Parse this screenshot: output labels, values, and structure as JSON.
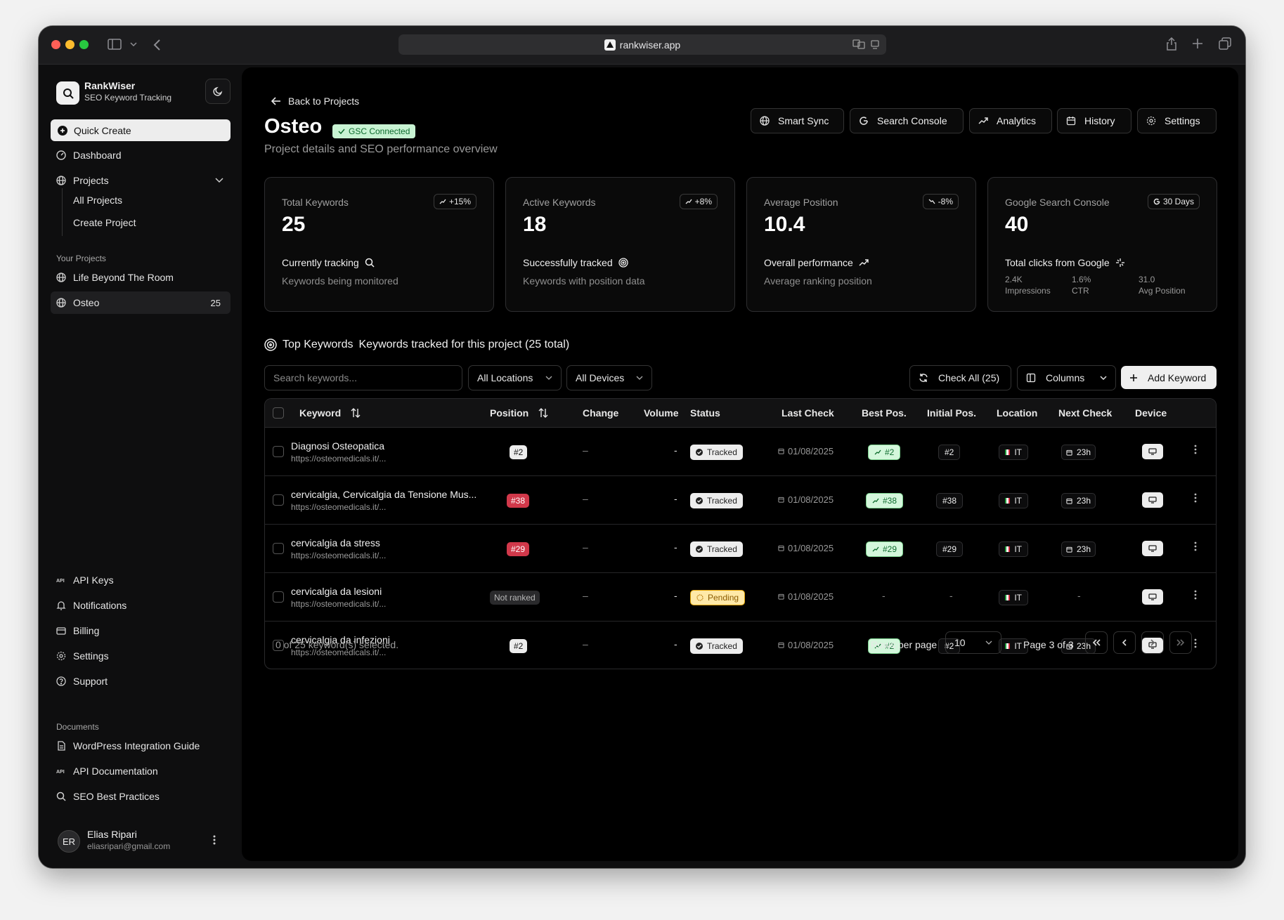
{
  "browser": {
    "url": "rankwiser.app"
  },
  "brand": {
    "name": "RankWiser",
    "subtitle": "SEO Keyword Tracking"
  },
  "sidebar": {
    "quick_create": "Quick Create",
    "dashboard": "Dashboard",
    "projects": "Projects",
    "all_projects": "All Projects",
    "create_project": "Create Project",
    "your_projects_label": "Your Projects",
    "project_items": [
      {
        "label": "Life Beyond The Room",
        "count": ""
      },
      {
        "label": "Osteo",
        "count": "25"
      }
    ],
    "api_keys": "API Keys",
    "notifications": "Notifications",
    "billing": "Billing",
    "settings": "Settings",
    "support": "Support",
    "documents_label": "Documents",
    "documents": [
      "WordPress Integration Guide",
      "API Documentation",
      "SEO Best Practices"
    ],
    "user": {
      "initials": "ER",
      "name": "Elias Ripari",
      "email": "eliasripari@gmail.com"
    }
  },
  "page": {
    "back": "Back to Projects",
    "title": "Osteo",
    "gsc_badge": "GSC Connected",
    "subtitle": "Project details and SEO performance overview",
    "toolbar": [
      "Smart Sync",
      "Search Console",
      "Analytics",
      "History",
      "Settings"
    ]
  },
  "stats": [
    {
      "label": "Total Keywords",
      "value": "25",
      "badge": "+15%",
      "foot": "Currently tracking",
      "sub": "Keywords being monitored"
    },
    {
      "label": "Active Keywords",
      "value": "18",
      "badge": "+8%",
      "foot": "Successfully tracked",
      "sub": "Keywords with position data"
    },
    {
      "label": "Average Position",
      "value": "10.4",
      "badge": "-8%",
      "foot": "Overall performance",
      "sub": "Average ranking position"
    },
    {
      "label": "Google Search Console",
      "value": "40",
      "badge": "30 Days",
      "foot": "Total clicks from Google",
      "mini": [
        {
          "value": "2.4K",
          "label": "Impressions"
        },
        {
          "value": "1.6%",
          "label": "CTR"
        },
        {
          "value": "31.0",
          "label": "Avg Position"
        }
      ]
    }
  ],
  "keywords": {
    "title": "Top Keywords",
    "subtitle": "Keywords tracked for this project (25 total)",
    "search_placeholder": "Search keywords...",
    "location_filter": "All Locations",
    "device_filter": "All Devices",
    "check_all": "Check All (25)",
    "columns": "Columns",
    "add_keyword": "Add Keyword",
    "headers": [
      "Keyword",
      "Position",
      "Change",
      "Volume",
      "Status",
      "Last Check",
      "Best Pos.",
      "Initial Pos.",
      "Location",
      "Next Check",
      "Device"
    ],
    "rows": [
      {
        "keyword": "Diagnosi Osteopatica",
        "url": "https://osteomedicals.it/...",
        "position": "#2",
        "pos_style": "white",
        "change": "–",
        "volume": "-",
        "status": "Tracked",
        "last_check": "01/08/2025",
        "best": "#2",
        "initial": "#2",
        "location": "IT",
        "next": "23h"
      },
      {
        "keyword": "cervicalgia, Cervicalgia da Tensione Mus...",
        "url": "https://osteomedicals.it/...",
        "position": "#38",
        "pos_style": "red",
        "change": "–",
        "volume": "-",
        "status": "Tracked",
        "last_check": "01/08/2025",
        "best": "#38",
        "initial": "#38",
        "location": "IT",
        "next": "23h"
      },
      {
        "keyword": "cervicalgia da stress",
        "url": "https://osteomedicals.it/...",
        "position": "#29",
        "pos_style": "red",
        "change": "–",
        "volume": "-",
        "status": "Tracked",
        "last_check": "01/08/2025",
        "best": "#29",
        "initial": "#29",
        "location": "IT",
        "next": "23h"
      },
      {
        "keyword": "cervicalgia da lesioni",
        "url": "https://osteomedicals.it/...",
        "position": "Not ranked",
        "pos_style": "gray",
        "change": "–",
        "volume": "-",
        "status": "Pending",
        "last_check": "01/08/2025",
        "best": "-",
        "initial": "-",
        "location": "IT",
        "next": "-"
      },
      {
        "keyword": "cervicalgia da infezioni",
        "url": "https://osteomedicals.it/...",
        "position": "#2",
        "pos_style": "white",
        "change": "–",
        "volume": "-",
        "status": "Tracked",
        "last_check": "01/08/2025",
        "best": "#2",
        "initial": "#2",
        "location": "IT",
        "next": "23h"
      }
    ],
    "selected": "0 of 25 keyword(s) selected.",
    "rows_per_page_label": "Rows per page",
    "rows_per_page": "10",
    "page_info": "Page 3 of 3"
  },
  "colors": {
    "accent_green": "#c8f3d3",
    "danger_red": "#d1384a",
    "pending_amber": "#ffe9a8"
  }
}
